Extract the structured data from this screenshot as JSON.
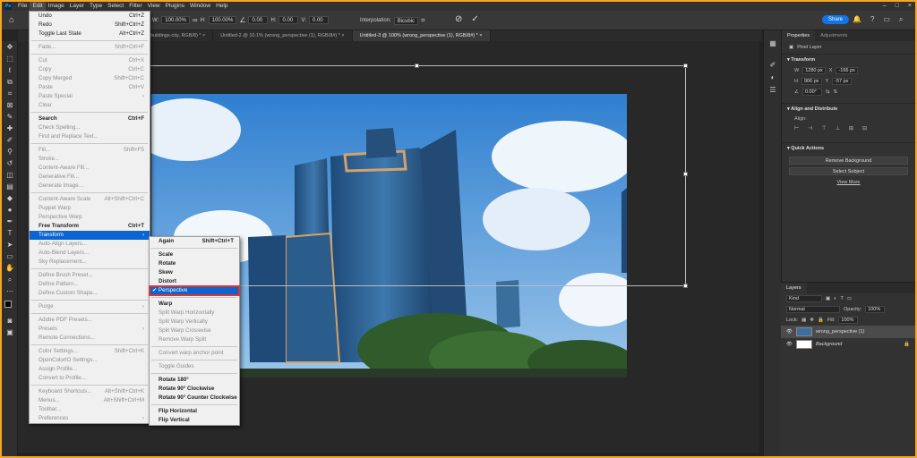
{
  "menubar": {
    "logo": "Ps",
    "items": [
      "File",
      "Edit",
      "Image",
      "Layer",
      "Type",
      "Select",
      "Filter",
      "View",
      "Plugins",
      "Window",
      "Help"
    ]
  },
  "options": {
    "w_label": "W:",
    "w_value": "100.00%",
    "h_label": "H:",
    "h_value": "100.00%",
    "angle_value": "0.00",
    "h_skew_label": "H:",
    "h_skew_value": "0.00",
    "v_skew_label": "V:",
    "v_skew_value": "0.00",
    "interp_label": "Interpolation:",
    "interp_value": "Bicubic",
    "share_label": "Share"
  },
  "tabs": [
    {
      "label": "buildings-city, RGB/8) *  ×",
      "active": false
    },
    {
      "label": "Untitled-2 @ 10.1% (wrong_perspective (1), RGB/8#) *  ×",
      "active": false
    },
    {
      "label": "Untitled-3 @ 100% (wrong_perspective (1), RGB/8#) *  ×",
      "active": true
    }
  ],
  "edit_menu": [
    {
      "label": "Undo",
      "sc": "Ctrl+Z",
      "dis": false
    },
    {
      "label": "Redo",
      "sc": "Shift+Ctrl+Z",
      "dis": false
    },
    {
      "label": "Toggle Last State",
      "sc": "Alt+Ctrl+Z",
      "dis": false
    },
    {
      "sep": true
    },
    {
      "label": "Fade...",
      "sc": "Shift+Ctrl+F",
      "dis": true
    },
    {
      "sep": true
    },
    {
      "label": "Cut",
      "sc": "Ctrl+X",
      "dis": true
    },
    {
      "label": "Copy",
      "sc": "Ctrl+C",
      "dis": true
    },
    {
      "label": "Copy Merged",
      "sc": "Shift+Ctrl+C",
      "dis": true
    },
    {
      "label": "Paste",
      "sc": "Ctrl+V",
      "dis": true
    },
    {
      "label": "Paste Special",
      "sc": "›",
      "dis": true
    },
    {
      "label": "Clear",
      "sc": "",
      "dis": true
    },
    {
      "sep": true
    },
    {
      "label": "Search",
      "sc": "Ctrl+F",
      "dis": false,
      "bold": true
    },
    {
      "label": "Check Spelling...",
      "sc": "",
      "dis": true
    },
    {
      "label": "Find and Replace Text...",
      "sc": "",
      "dis": true
    },
    {
      "sep": true
    },
    {
      "label": "Fill...",
      "sc": "Shift+F5",
      "dis": true
    },
    {
      "label": "Stroke...",
      "sc": "",
      "dis": true
    },
    {
      "label": "Content-Aware Fill...",
      "sc": "",
      "dis": true
    },
    {
      "label": "Generative Fill...",
      "sc": "",
      "dis": true
    },
    {
      "label": "Generate Image...",
      "sc": "",
      "dis": true
    },
    {
      "sep": true
    },
    {
      "label": "Content-Aware Scale",
      "sc": "Alt+Shift+Ctrl+C",
      "dis": true
    },
    {
      "label": "Puppet Warp",
      "sc": "",
      "dis": true
    },
    {
      "label": "Perspective Warp",
      "sc": "",
      "dis": true
    },
    {
      "label": "Free Transform",
      "sc": "Ctrl+T",
      "dis": false,
      "bold": true
    },
    {
      "label": "Transform",
      "sc": "›",
      "dis": false,
      "hl": true
    },
    {
      "label": "Auto-Align Layers...",
      "sc": "",
      "dis": true
    },
    {
      "label": "Auto-Blend Layers...",
      "sc": "",
      "dis": true
    },
    {
      "label": "Sky Replacement...",
      "sc": "",
      "dis": true
    },
    {
      "sep": true
    },
    {
      "label": "Define Brush Preset...",
      "sc": "",
      "dis": true
    },
    {
      "label": "Define Pattern...",
      "sc": "",
      "dis": true
    },
    {
      "label": "Define Custom Shape...",
      "sc": "",
      "dis": true
    },
    {
      "sep": true
    },
    {
      "label": "Purge",
      "sc": "›",
      "dis": true
    },
    {
      "sep": true
    },
    {
      "label": "Adobe PDF Presets...",
      "sc": "",
      "dis": true
    },
    {
      "label": "Presets",
      "sc": "›",
      "dis": true
    },
    {
      "label": "Remote Connections...",
      "sc": "",
      "dis": true
    },
    {
      "sep": true
    },
    {
      "label": "Color Settings...",
      "sc": "Shift+Ctrl+K",
      "dis": true
    },
    {
      "label": "OpenColorIO Settings...",
      "sc": "",
      "dis": true
    },
    {
      "label": "Assign Profile...",
      "sc": "",
      "dis": true
    },
    {
      "label": "Convert to Profile...",
      "sc": "",
      "dis": true
    },
    {
      "sep": true
    },
    {
      "label": "Keyboard Shortcuts...",
      "sc": "Alt+Shift+Ctrl+K",
      "dis": true
    },
    {
      "label": "Menus...",
      "sc": "Alt+Shift+Ctrl+M",
      "dis": true
    },
    {
      "label": "Toolbar...",
      "sc": "",
      "dis": true
    },
    {
      "label": "Preferences",
      "sc": "›",
      "dis": true
    }
  ],
  "transform_menu": [
    {
      "label": "Again",
      "sc": "Shift+Ctrl+T",
      "bold": true
    },
    {
      "sep": true
    },
    {
      "label": "Scale",
      "sc": "",
      "bold": true
    },
    {
      "label": "Rotate",
      "sc": "",
      "bold": true
    },
    {
      "label": "Skew",
      "sc": "",
      "bold": true
    },
    {
      "label": "Distort",
      "sc": "",
      "bold": true
    },
    {
      "label": "Perspective",
      "sc": "",
      "sel": true
    },
    {
      "sep": true
    },
    {
      "label": "Warp",
      "sc": "",
      "bold": true
    },
    {
      "label": "Split Warp Horizontally",
      "sc": "",
      "dis": true
    },
    {
      "label": "Split Warp Vertically",
      "sc": "",
      "dis": true
    },
    {
      "label": "Split Warp Crosswise",
      "sc": "",
      "dis": true
    },
    {
      "label": "Remove Warp Split",
      "sc": "",
      "dis": true
    },
    {
      "sep": true
    },
    {
      "label": "Convert warp anchor point",
      "sc": "",
      "dis": true
    },
    {
      "sep": true
    },
    {
      "label": "Toggle Guides",
      "sc": "",
      "dis": true
    },
    {
      "sep": true
    },
    {
      "label": "Rotate 180°",
      "sc": "",
      "bold": true
    },
    {
      "label": "Rotate 90° Clockwise",
      "sc": "",
      "bold": true
    },
    {
      "label": "Rotate 90° Counter Clockwise",
      "sc": "",
      "bold": true
    },
    {
      "sep": true
    },
    {
      "label": "Flip Horizontal",
      "sc": "",
      "bold": true
    },
    {
      "label": "Flip Vertical",
      "sc": "",
      "bold": true
    }
  ],
  "properties": {
    "tabs": [
      "Properties",
      "Adjustments"
    ],
    "pixel_layer": "Pixel Layer",
    "transform_title": "Transform",
    "w_label": "W",
    "w_value": "1280 px",
    "x_label": "X",
    "x_value": "-166 px",
    "h_label": "H",
    "h_value": "906 px",
    "y_label": "Y",
    "y_value": "-57 px",
    "angle_value": "0.00°",
    "align_title": "Align and Distribute",
    "align_label": "Align:",
    "qa_title": "Quick Actions",
    "remove_bg": "Remove Background",
    "select_subject": "Select Subject",
    "view_more": "View More"
  },
  "layers": {
    "title": "Layers",
    "kind": "Kind",
    "blend": "Normal",
    "opacity_label": "Opacity:",
    "opacity_value": "100%",
    "lock_label": "Lock:",
    "fill_label": "Fill:",
    "fill_value": "100%",
    "items": [
      {
        "name": "wrong_perspective (1)",
        "selected": true
      },
      {
        "name": "Background",
        "selected": false
      }
    ]
  },
  "colors": {
    "border": "#f5a623",
    "accent": "#1473e6",
    "highlight": "#0a64d2",
    "callout": "#e0352b"
  }
}
